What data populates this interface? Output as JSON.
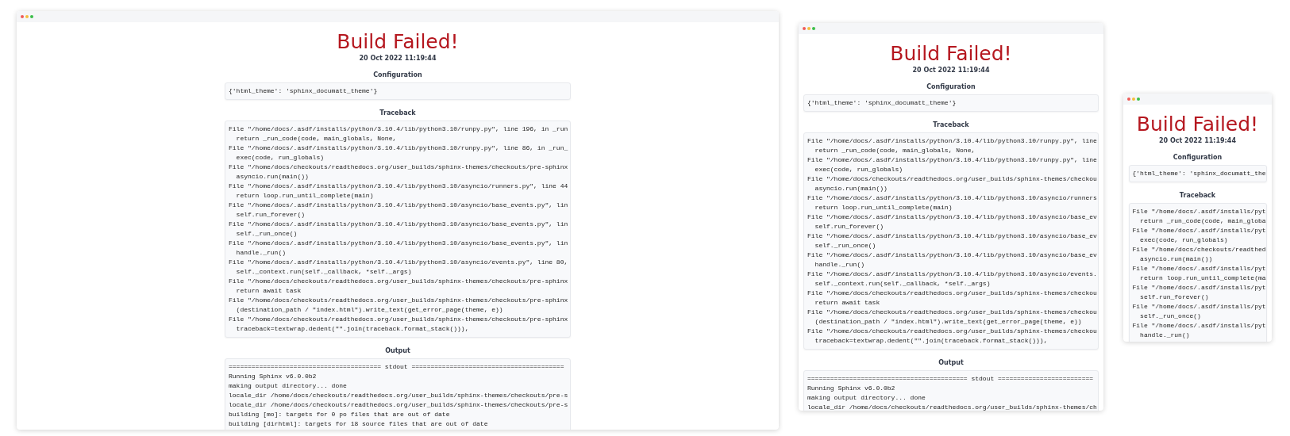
{
  "windows": [
    {
      "title": "Build Failed!",
      "timestamp": "20 Oct 2022 11:19:44",
      "sections": [
        {
          "heading": "Configuration",
          "lines": [
            "{'html_theme': 'sphinx_documatt_theme'}"
          ]
        },
        {
          "heading": "Traceback",
          "lines": [
            "File \"/home/docs/.asdf/installs/python/3.10.4/lib/python3.10/runpy.py\", line 196, in _run",
            "  return _run_code(code, main_globals, None,",
            "File \"/home/docs/.asdf/installs/python/3.10.4/lib/python3.10/runpy.py\", line 86, in _run_",
            "  exec(code, run_globals)",
            "File \"/home/docs/checkouts/readthedocs.org/user_builds/sphinx-themes/checkouts/pre-sphinx",
            "  asyncio.run(main())",
            "File \"/home/docs/.asdf/installs/python/3.10.4/lib/python3.10/asyncio/runners.py\", line 44",
            "  return loop.run_until_complete(main)",
            "File \"/home/docs/.asdf/installs/python/3.10.4/lib/python3.10/asyncio/base_events.py\", lin",
            "  self.run_forever()",
            "File \"/home/docs/.asdf/installs/python/3.10.4/lib/python3.10/asyncio/base_events.py\", lin",
            "  self._run_once()",
            "File \"/home/docs/.asdf/installs/python/3.10.4/lib/python3.10/asyncio/base_events.py\", lin",
            "  handle._run()",
            "File \"/home/docs/.asdf/installs/python/3.10.4/lib/python3.10/asyncio/events.py\", line 80,",
            "  self._context.run(self._callback, *self._args)",
            "File \"/home/docs/checkouts/readthedocs.org/user_builds/sphinx-themes/checkouts/pre-sphinx",
            "  return await task",
            "File \"/home/docs/checkouts/readthedocs.org/user_builds/sphinx-themes/checkouts/pre-sphinx",
            "  (destination_path / \"index.html\").write_text(get_error_page(theme, e))",
            "File \"/home/docs/checkouts/readthedocs.org/user_builds/sphinx-themes/checkouts/pre-sphinx",
            "  traceback=textwrap.dedent(\"\".join(traceback.format_stack())),"
          ]
        },
        {
          "heading": "Output",
          "lines": [
            "======================================== stdout ========================================",
            "Running Sphinx v6.0.0b2",
            "making output directory... done",
            "locale_dir /home/docs/checkouts/readthedocs.org/user_builds/sphinx-themes/checkouts/pre-s",
            "locale_dir /home/docs/checkouts/readthedocs.org/user_builds/sphinx-themes/checkouts/pre-s",
            "building [mo]: targets for 0 po files that are out of date",
            "building [dirhtml]: targets for 18 source files that are out of date"
          ]
        }
      ]
    },
    {
      "title": "Build Failed!",
      "timestamp": "20 Oct 2022 11:19:44",
      "sections": [
        {
          "heading": "Configuration",
          "lines": [
            "{'html_theme': 'sphinx_documatt_theme'}"
          ]
        },
        {
          "heading": "Traceback",
          "lines": [
            "File \"/home/docs/.asdf/installs/python/3.10.4/lib/python3.10/runpy.py\", line",
            "  return _run_code(code, main_globals, None,",
            "File \"/home/docs/.asdf/installs/python/3.10.4/lib/python3.10/runpy.py\", line",
            "  exec(code, run_globals)",
            "File \"/home/docs/checkouts/readthedocs.org/user_builds/sphinx-themes/checkou",
            "  asyncio.run(main())",
            "File \"/home/docs/.asdf/installs/python/3.10.4/lib/python3.10/asyncio/runners",
            "  return loop.run_until_complete(main)",
            "File \"/home/docs/.asdf/installs/python/3.10.4/lib/python3.10/asyncio/base_ev",
            "  self.run_forever()",
            "File \"/home/docs/.asdf/installs/python/3.10.4/lib/python3.10/asyncio/base_ev",
            "  self._run_once()",
            "File \"/home/docs/.asdf/installs/python/3.10.4/lib/python3.10/asyncio/base_ev",
            "  handle._run()",
            "File \"/home/docs/.asdf/installs/python/3.10.4/lib/python3.10/asyncio/events.",
            "  self._context.run(self._callback, *self._args)",
            "File \"/home/docs/checkouts/readthedocs.org/user_builds/sphinx-themes/checkou",
            "  return await task",
            "File \"/home/docs/checkouts/readthedocs.org/user_builds/sphinx-themes/checkou",
            "  (destination_path / \"index.html\").write_text(get_error_page(theme, e))",
            "File \"/home/docs/checkouts/readthedocs.org/user_builds/sphinx-themes/checkou",
            "  traceback=textwrap.dedent(\"\".join(traceback.format_stack())),"
          ]
        },
        {
          "heading": "Output",
          "lines": [
            "========================================== stdout =========================",
            "Running Sphinx v6.0.0b2",
            "making output directory... done",
            "locale_dir /home/docs/checkouts/readthedocs.org/user_builds/sphinx-themes/ch"
          ]
        }
      ]
    },
    {
      "title": "Build Failed!",
      "timestamp": "20 Oct 2022 11:19:44",
      "sections": [
        {
          "heading": "Configuration",
          "lines": [
            "{'html_theme': 'sphinx_documatt_the"
          ]
        },
        {
          "heading": "Traceback",
          "lines": [
            "File \"/home/docs/.asdf/installs/pyt",
            "  return _run_code(code, main_globa",
            "File \"/home/docs/.asdf/installs/pyt",
            "  exec(code, run_globals)",
            "File \"/home/docs/checkouts/readthed",
            "  asyncio.run(main())",
            "File \"/home/docs/.asdf/installs/pyt",
            "  return loop.run_until_complete(ma",
            "File \"/home/docs/.asdf/installs/pyt",
            "  self.run_forever()",
            "File \"/home/docs/.asdf/installs/pyt",
            "  self._run_once()",
            "File \"/home/docs/.asdf/installs/pyt",
            "  handle._run()"
          ]
        }
      ]
    }
  ]
}
